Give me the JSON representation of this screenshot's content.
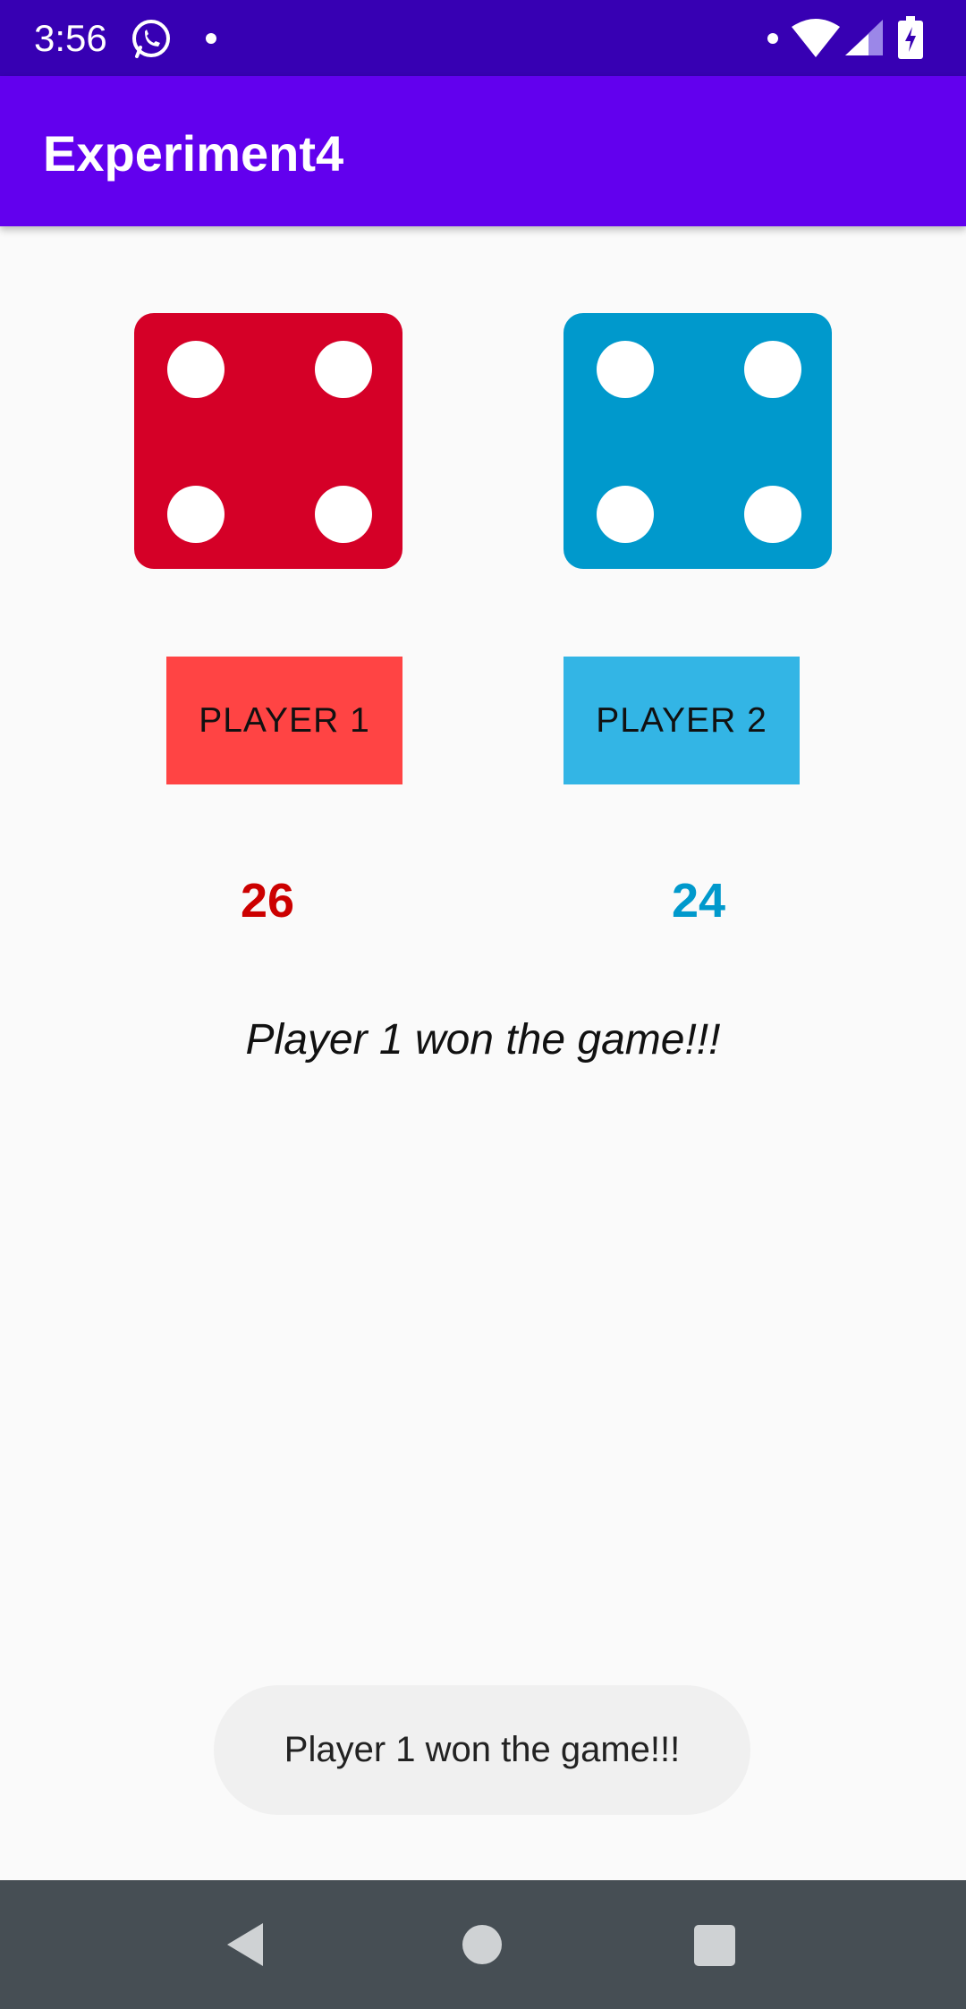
{
  "status_bar": {
    "time": "3:56"
  },
  "app_bar": {
    "title": "Experiment4"
  },
  "dice": [
    {
      "player": 1,
      "face_value": 4,
      "color": "#d50027"
    },
    {
      "player": 2,
      "face_value": 4,
      "color": "#0099cc"
    }
  ],
  "buttons": {
    "player1_label": "PLAYER 1",
    "player2_label": "PLAYER 2"
  },
  "scores": {
    "player1": "26",
    "player2": "24"
  },
  "result": {
    "message": "Player 1 won the game!!!"
  },
  "toast": {
    "message": "Player 1 won the game!!!"
  },
  "colors": {
    "status_bar": "#3700b3",
    "app_bar": "#6200ee",
    "player1_button": "#ff4444",
    "player2_button": "#33b5e5",
    "player1_score": "#cc0000",
    "player2_score": "#0099cc",
    "nav_bar": "#464e54"
  },
  "icons": {
    "status_bar": [
      "whatsapp-icon",
      "notification-dot-icon",
      "wifi-icon",
      "cell-signal-icon",
      "battery-charging-icon"
    ],
    "nav_bar": [
      "back-icon",
      "home-icon",
      "recents-icon"
    ]
  }
}
